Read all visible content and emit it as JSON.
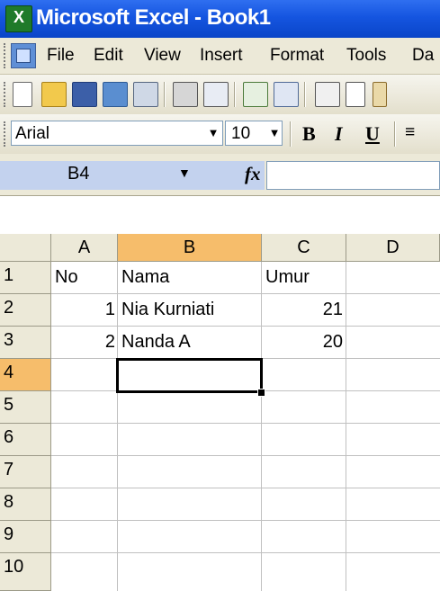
{
  "window": {
    "title": "Microsoft Excel - Book1"
  },
  "menu": [
    "File",
    "Edit",
    "View",
    "Insert",
    "Format",
    "Tools",
    "Da"
  ],
  "formatting": {
    "font": "Arial",
    "size": "10",
    "bold": "B",
    "italic": "I",
    "underline": "U"
  },
  "formula_bar": {
    "name_box": "B4",
    "fx": "fx",
    "value": ""
  },
  "columns": [
    "A",
    "B",
    "C",
    "D"
  ],
  "rows": [
    "1",
    "2",
    "3",
    "4",
    "5",
    "6",
    "7",
    "8",
    "9",
    "10"
  ],
  "cells": {
    "A1": "No",
    "B1": "Nama",
    "C1": "Umur",
    "A2": "1",
    "B2": "Nia Kurniati",
    "C2": "21",
    "A3": "2",
    "B3": "Nanda A",
    "C3": "20"
  },
  "selected_cell": "B4",
  "colors": {
    "titlebar": "#0a45c8",
    "active_header": "#f6bd6b",
    "namebox_bg": "#c3d2ee"
  }
}
